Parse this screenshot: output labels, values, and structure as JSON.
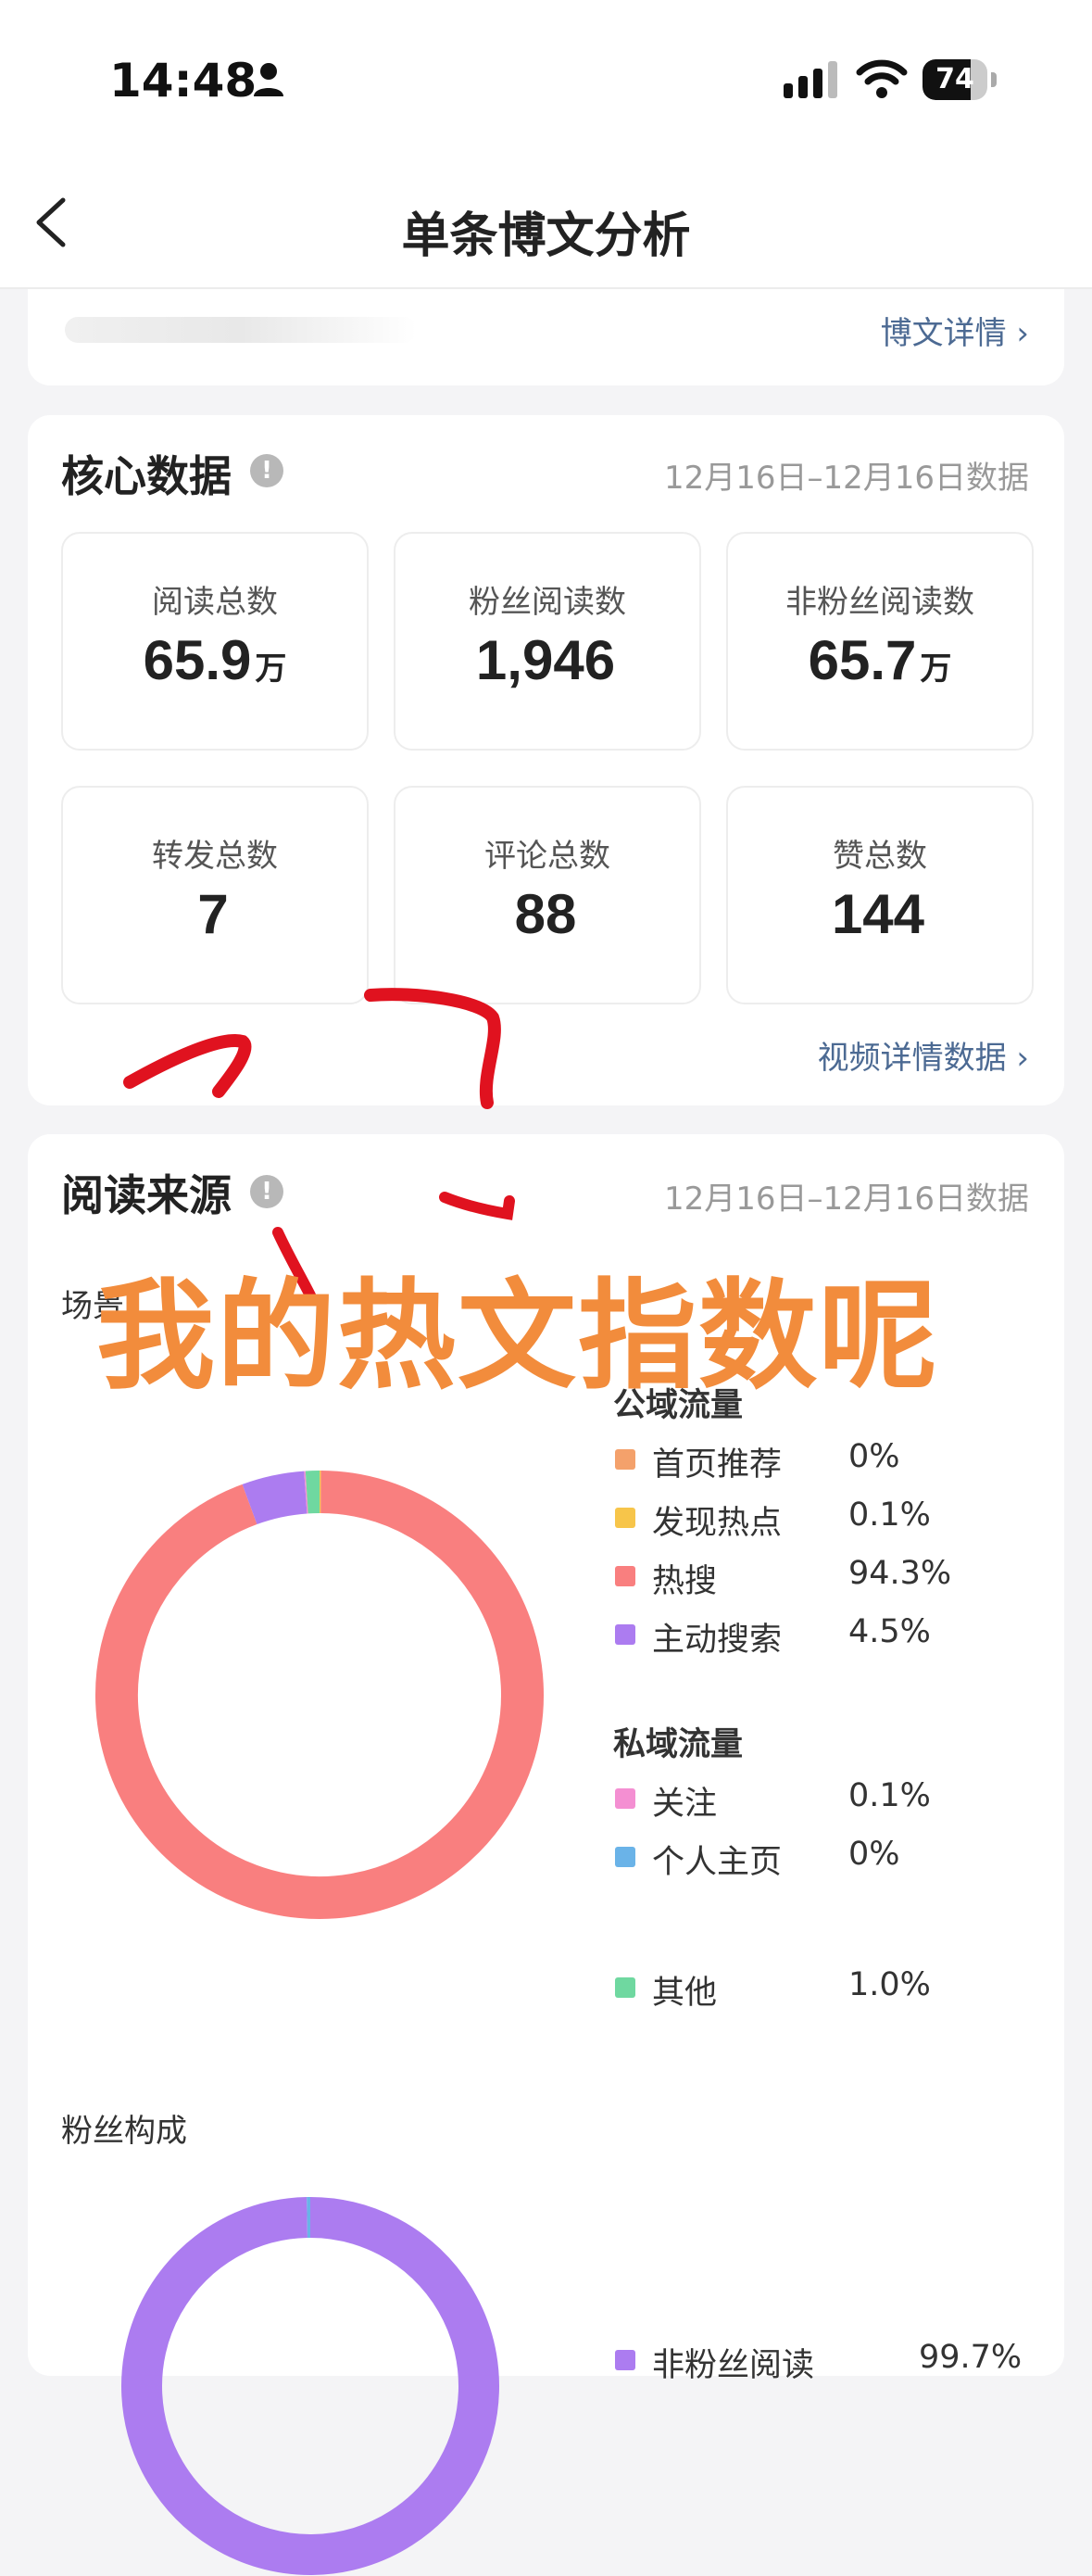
{
  "status_bar": {
    "time": "14:48",
    "battery": "74",
    "battery_level": 0.74
  },
  "nav": {
    "title": "单条博文分析"
  },
  "post_card": {
    "detail_link": "博文详情 ›"
  },
  "core": {
    "title": "核心数据",
    "date_range": "12月16日–12月16日数据",
    "stats": [
      {
        "label": "阅读总数",
        "value": "65.9",
        "unit": "万"
      },
      {
        "label": "粉丝阅读数",
        "value": "1,946",
        "unit": ""
      },
      {
        "label": "非粉丝阅读数",
        "value": "65.7",
        "unit": "万"
      },
      {
        "label": "转发总数",
        "value": "7",
        "unit": ""
      },
      {
        "label": "评论总数",
        "value": "88",
        "unit": ""
      },
      {
        "label": "赞总数",
        "value": "144",
        "unit": ""
      }
    ],
    "video_link": "视频详情数据 ›"
  },
  "source": {
    "title": "阅读来源",
    "date_range": "12月16日–12月16日数据",
    "scene_label": "场景",
    "public_heading": "公域流量",
    "private_heading": "私域流量",
    "legend": [
      {
        "name": "首页推荐",
        "pct": "0%",
        "color": "#f4a16b",
        "value": 0
      },
      {
        "name": "发现热点",
        "pct": "0.1%",
        "color": "#f7c54a",
        "value": 0.1
      },
      {
        "name": "热搜",
        "pct": "94.3%",
        "color": "#f97f7f",
        "value": 94.3
      },
      {
        "name": "主动搜索",
        "pct": "4.5%",
        "color": "#ac7cf0",
        "value": 4.5
      },
      {
        "name": "关注",
        "pct": "0.1%",
        "color": "#f48fd2",
        "value": 0.1
      },
      {
        "name": "个人主页",
        "pct": "0%",
        "color": "#6ab3e8",
        "value": 0
      },
      {
        "name": "其他",
        "pct": "1.0%",
        "color": "#6fd8a0",
        "value": 1.0
      }
    ],
    "fans_label": "粉丝构成",
    "fans_legend": {
      "name": "非粉丝阅读",
      "pct": "99.7%",
      "color": "#ac7cf0"
    },
    "fans_values": [
      {
        "value": 99.7,
        "color": "#ac7cf0"
      },
      {
        "value": 0.3,
        "color": "#6ab3e8"
      }
    ]
  },
  "annotation": {
    "text": "我的热文指数呢",
    "color": "#f28c3c"
  }
}
